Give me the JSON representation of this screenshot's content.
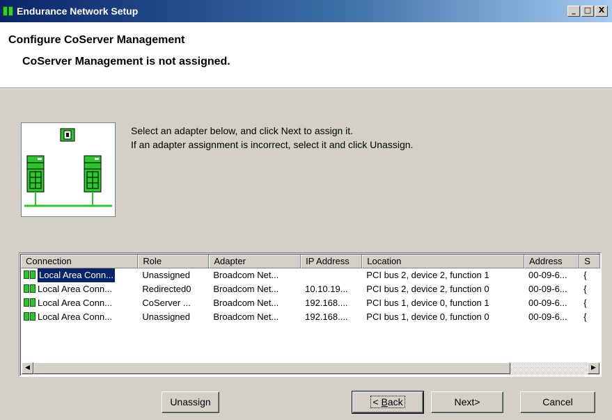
{
  "window": {
    "title": "Endurance Network Setup",
    "buttons": {
      "minimize": "_",
      "maximize": "□",
      "close": "X"
    }
  },
  "header": {
    "title": "Configure CoServer Management",
    "subtitle": "CoServer Management is not assigned."
  },
  "instructions": {
    "line1": "Select an adapter below, and click Next to assign it.",
    "line2": "If an adapter assignment is incorrect, select it and click Unassign."
  },
  "table": {
    "columns": [
      "Connection",
      "Role",
      "Adapter",
      "IP Address",
      "Location",
      "Address",
      "S"
    ],
    "rows": [
      {
        "connection": "Local Area Conn...",
        "role": "Unassigned",
        "adapter": "Broadcom Net...",
        "ip": "",
        "location": "PCI bus 2, device 2, function 1",
        "address": "00-09-6...",
        "s": "{",
        "selected": true
      },
      {
        "connection": "Local Area Conn...",
        "role": "Redirected0",
        "adapter": "Broadcom Net...",
        "ip": "10.10.19...",
        "location": "PCI bus 2, device 2, function 0",
        "address": "00-09-6...",
        "s": "{"
      },
      {
        "connection": "Local Area Conn...",
        "role": "CoServer ...",
        "adapter": "Broadcom Net...",
        "ip": "192.168....",
        "location": "PCI bus 1, device 0, function 1",
        "address": "00-09-6...",
        "s": "{"
      },
      {
        "connection": "Local Area Conn...",
        "role": "Unassigned",
        "adapter": "Broadcom Net...",
        "ip": "192.168....",
        "location": "PCI bus 1, device 0, function 0",
        "address": "00-09-6...",
        "s": "{"
      }
    ],
    "scrollbar": {
      "left_arrow": "◀",
      "right_arrow": "▶"
    }
  },
  "buttons": {
    "unassign": "Unassign",
    "back_prefix": "< ",
    "back_hotkey": "B",
    "back_rest": "ack",
    "next": "Next>",
    "cancel": "Cancel"
  },
  "colors": {
    "title_gradient_start": "#0a246a",
    "title_gradient_end": "#a6caf0",
    "selection": "#0a246a",
    "network_green": "#2fc42f",
    "dialog_face": "#d4d0c8"
  }
}
